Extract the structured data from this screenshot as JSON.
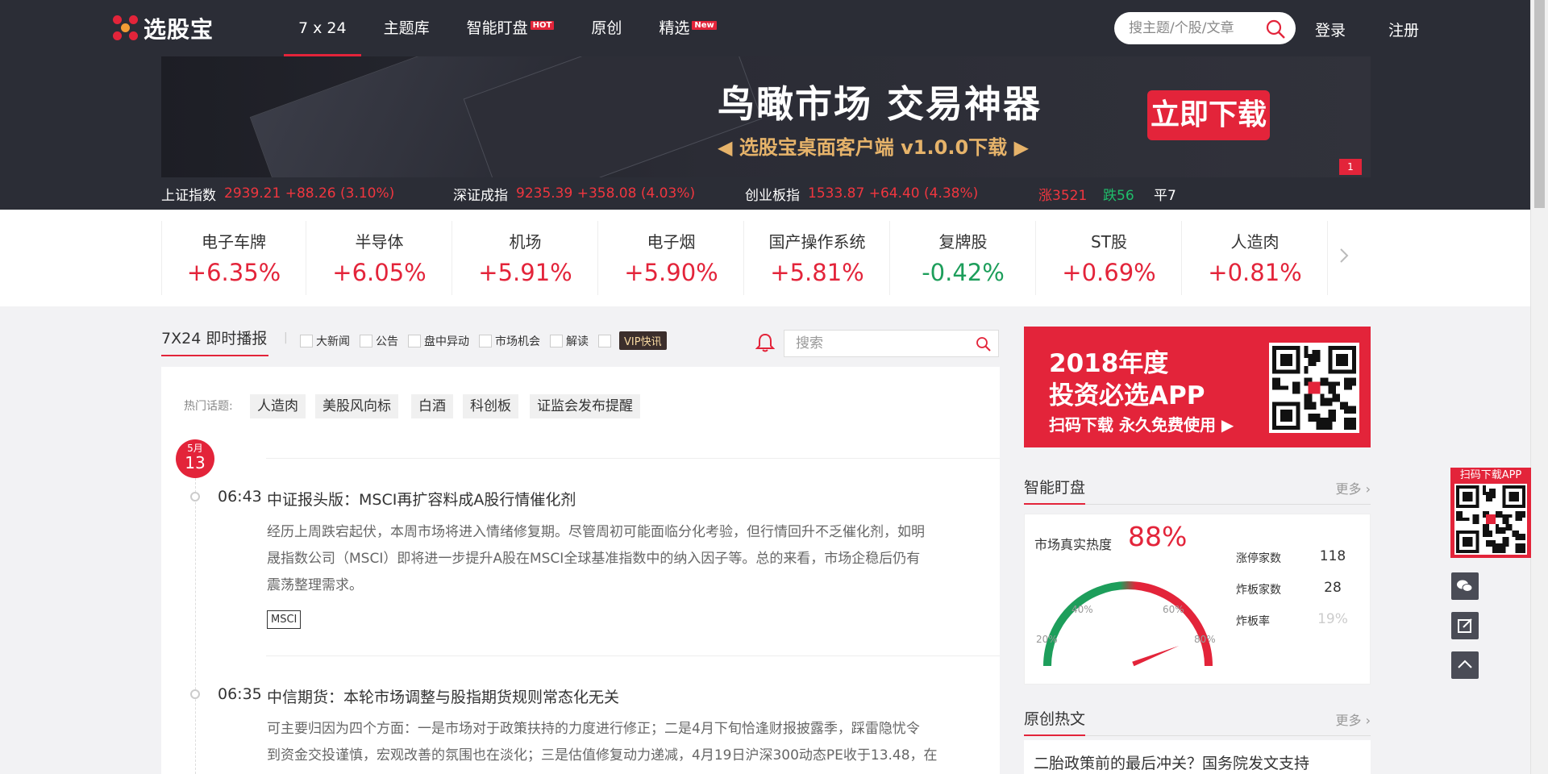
{
  "brand": {
    "name": "选股宝"
  },
  "nav": {
    "items": [
      {
        "label": "7 x 24"
      },
      {
        "label": "主题库"
      },
      {
        "label": "智能盯盘",
        "badge": "HOT"
      },
      {
        "label": "原创"
      },
      {
        "label": "精选",
        "badge": "New"
      }
    ],
    "search_placeholder": "搜主题/个股/文章",
    "login": "登录",
    "register": "注册"
  },
  "banner": {
    "headline": "鸟瞰市场  交易神器",
    "subline": "◀ 选股宝桌面客户端 v1.0.0下载 ▶",
    "cta": "立即下载",
    "page": "1"
  },
  "indices": [
    {
      "name": "上证指数",
      "value": "2939.21 +88.26 (3.10%)"
    },
    {
      "name": "深证成指",
      "value": "9235.39 +358.08 (4.03%)"
    },
    {
      "name": "创业板指",
      "value": "1533.87 +64.40 (4.38%)"
    }
  ],
  "breadth": {
    "up": "涨3521",
    "down": "跌56",
    "flat": "平7"
  },
  "sectors": [
    {
      "name": "电子车牌",
      "change": "+6.35%",
      "dir": "up"
    },
    {
      "name": "半导体",
      "change": "+6.05%",
      "dir": "up"
    },
    {
      "name": "机场",
      "change": "+5.91%",
      "dir": "up"
    },
    {
      "name": "电子烟",
      "change": "+5.90%",
      "dir": "up"
    },
    {
      "name": "国产操作系统",
      "change": "+5.81%",
      "dir": "up"
    },
    {
      "name": "复牌股",
      "change": "-0.42%",
      "dir": "down"
    },
    {
      "name": "ST股",
      "change": "+0.69%",
      "dir": "up"
    },
    {
      "name": "人造肉",
      "change": "+0.81%",
      "dir": "up"
    }
  ],
  "feed": {
    "title": "7X24 即时播报",
    "filters": [
      "大新闻",
      "公告",
      "盘中异动",
      "市场机会",
      "解读"
    ],
    "vip": "VIP快讯",
    "search_placeholder": "搜索",
    "hot_label": "热门话题:",
    "hot_topics": [
      "人造肉",
      "美股风向标",
      "白酒",
      "科创板",
      "证监会发布提醒"
    ],
    "date": {
      "month": "5月",
      "day": "13"
    },
    "items": [
      {
        "time": "06:43",
        "title": "中证报头版：MSCI再扩容料成A股行情催化剂",
        "body": [
          "经历上周跌宕起伏，本周市场将进入情绪修复期。尽管周初可能面临分化考验，但行情回升不乏催化剂，如明",
          "晟指数公司（MSCI）即将进一步提升A股在MSCI全球基准指数中的纳入因子等。总的来看，市场企稳后仍有",
          "震荡整理需求。"
        ],
        "tag": "MSCI"
      },
      {
        "time": "06:35",
        "title": "中信期货：本轮市场调整与股指期货规则常态化无关",
        "body": [
          "可主要归因为四个方面：一是市场对于政策扶持的力度进行修正；二是4月下旬恰逢财报披露季，踩雷隐忧令",
          "到资金交投谨慎，宏观改善的氛围也在淡化；三是估值修复动力递减，4月19日沪深300动态PE收于13.48，在"
        ]
      }
    ]
  },
  "promo": {
    "line1": "2018年度",
    "line2": "投资必选APP",
    "line3": "扫码下载 永久免费使用 ▶"
  },
  "monitor": {
    "title": "智能盯盘",
    "more": "更多",
    "heat_label": "市场真实热度",
    "heat_value": "88%",
    "heat_fraction": 0.88,
    "gauge_ticks": [
      "20%",
      "40%",
      "60%",
      "80%"
    ],
    "stats": [
      {
        "label": "涨停家数",
        "value": "118"
      },
      {
        "label": "炸板家数",
        "value": "28"
      },
      {
        "label": "炸板率",
        "value": "19%"
      }
    ]
  },
  "original": {
    "title": "原创热文",
    "more": "更多",
    "first_item": "二胎政策前的最后冲关？国务院发文支持"
  },
  "sidebar": {
    "app_label": "扫码下载APP"
  },
  "colors": {
    "accent": "#e3243a",
    "up": "#e3243a",
    "down": "#1d9e5b",
    "dark": "#2b2d36"
  }
}
